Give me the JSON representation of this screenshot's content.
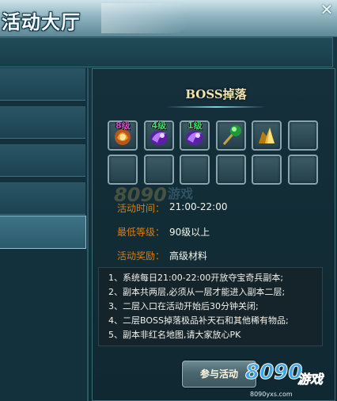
{
  "window": {
    "title": "活动大厅",
    "close_icon": "✕"
  },
  "boss_drops": {
    "title": "BOSS掉落",
    "items": [
      {
        "level": "8级",
        "level_color": "#d04cc8",
        "icon": "fire-gem-icon"
      },
      {
        "level": "4级",
        "level_color": "#47d86a",
        "icon": "purple-orb-icon"
      },
      {
        "level": "1级",
        "level_color": "#47d86a",
        "icon": "purple-orb-icon"
      },
      {
        "level": "",
        "level_color": "",
        "icon": "green-staff-icon"
      },
      {
        "level": "",
        "level_color": "",
        "icon": "gold-ore-icon"
      },
      {
        "level": "",
        "level_color": "",
        "icon": "empty"
      },
      {
        "level": "",
        "level_color": "",
        "icon": "empty"
      },
      {
        "level": "",
        "level_color": "",
        "icon": "empty"
      },
      {
        "level": "",
        "level_color": "",
        "icon": "empty"
      },
      {
        "level": "",
        "level_color": "",
        "icon": "empty"
      },
      {
        "level": "",
        "level_color": "",
        "icon": "empty"
      },
      {
        "level": "",
        "level_color": "",
        "icon": "empty"
      }
    ]
  },
  "info": {
    "time_label": "活动时间：",
    "time_value": "21:00-22:00",
    "level_label": "最低等级：",
    "level_value": "90级以上",
    "reward_label": "活动奖励：",
    "reward_value": "高级材料"
  },
  "rules": [
    "1、系统每日21:00-22:00开放夺宝奇兵副本;",
    "2、副本共两层,必须从一层才能进入副本二层;",
    "3、二层入口在活动开始后30分钟关闭;",
    "4、二层BOSS掉落极品补天石和其他稀有物品;",
    "5、副本非红名地图,请大家放心PK"
  ],
  "actions": {
    "join_label": "参与活动"
  },
  "watermark": {
    "logo_text": "8090",
    "logo_sub": "游戏",
    "url": "8090yxs.com"
  },
  "colors": {
    "label_orange": "#d97d12",
    "value_white": "#f4f4ea",
    "panel_border": "#3b6a79"
  }
}
